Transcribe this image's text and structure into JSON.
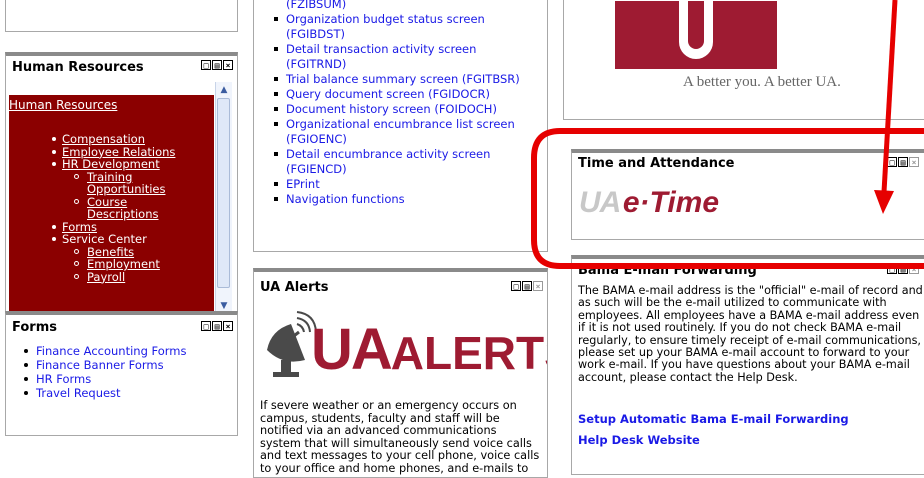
{
  "hr_portlet": {
    "title": "Human Resources",
    "menu_title": "Human Resources",
    "items": [
      {
        "label": "Compensation",
        "level": 1
      },
      {
        "label": "Employee Relations",
        "level": 1
      },
      {
        "label": "HR Development",
        "level": 1
      },
      {
        "label": "Training",
        "level": 2
      },
      {
        "label": "Opportunities",
        "level": 2,
        "continuation": true
      },
      {
        "label": "Course",
        "level": 2
      },
      {
        "label": "Descriptions",
        "level": 2,
        "continuation": true
      },
      {
        "label": "Forms",
        "level": 1
      },
      {
        "label": "Service Center",
        "level": 1,
        "no_underline": true
      },
      {
        "label": "Benefits",
        "level": 2
      },
      {
        "label": "Employment",
        "level": 2
      },
      {
        "label": "Payroll",
        "level": 2
      }
    ]
  },
  "forms_portlet": {
    "title": "Forms",
    "items": [
      "Finance Accounting Forms",
      "Finance Banner Forms",
      "HR Forms",
      "Travel Request"
    ]
  },
  "finance_list": {
    "items": [
      {
        "label": "(FZIBSUM)",
        "continuation": true
      },
      {
        "label": "Organization budget status screen"
      },
      {
        "label": "(FGIBDST)",
        "continuation": true
      },
      {
        "label": "Detail transaction activity screen"
      },
      {
        "label": "(FGITRND)",
        "continuation": true
      },
      {
        "label": "Trial balance summary screen (FGITBSR)"
      },
      {
        "label": "Query document screen (FGIDOCR)"
      },
      {
        "label": "Document history screen (FOIDOCH)"
      },
      {
        "label": "Organizational encumbrance list screen"
      },
      {
        "label": "(FGIOENC)",
        "continuation": true
      },
      {
        "label": "Detail encumbrance activity screen"
      },
      {
        "label": "(FGIENCD)",
        "continuation": true
      },
      {
        "label": "EPrint"
      },
      {
        "label": "Navigation functions"
      }
    ]
  },
  "alerts_portlet": {
    "title": "UA Alerts",
    "logo_text": "UA ALERTS",
    "body": "If severe weather or an emergency occurs on campus, students, faculty and staff will be notified via an advanced communications system that will simultaneously send voice calls and text messages to your cell phone, voice calls to your office and home phones, and e-mails to your"
  },
  "ua_logo": {
    "tagline": "A better you. A better UA.",
    "color": "#9e1b32"
  },
  "time_portlet": {
    "title": "Time and Attendance",
    "logo_text": "UA e·Time"
  },
  "bama_portlet": {
    "title": "Bama E-mail Forwarding",
    "body": "The BAMA e-mail address is the \"official\" e-mail of record and as such will be the e-mail utilized to communicate with employees. All employees have a BAMA e-mail address even if it is not used routinely. If you do not check BAMA e-mail regularly, to ensure timely receipt of e-mail communications, please set up your BAMA e-mail account to forward to your work e-mail. If you have questions about your BAMA e-mail account, please contact the Help Desk.",
    "link1": "Setup Automatic Bama E-mail Forwarding",
    "link2": "Help Desk Website"
  },
  "annotation": {
    "color": "#e60000"
  },
  "controls": {
    "minimize": "□",
    "maximize": "▤",
    "close": "×"
  }
}
